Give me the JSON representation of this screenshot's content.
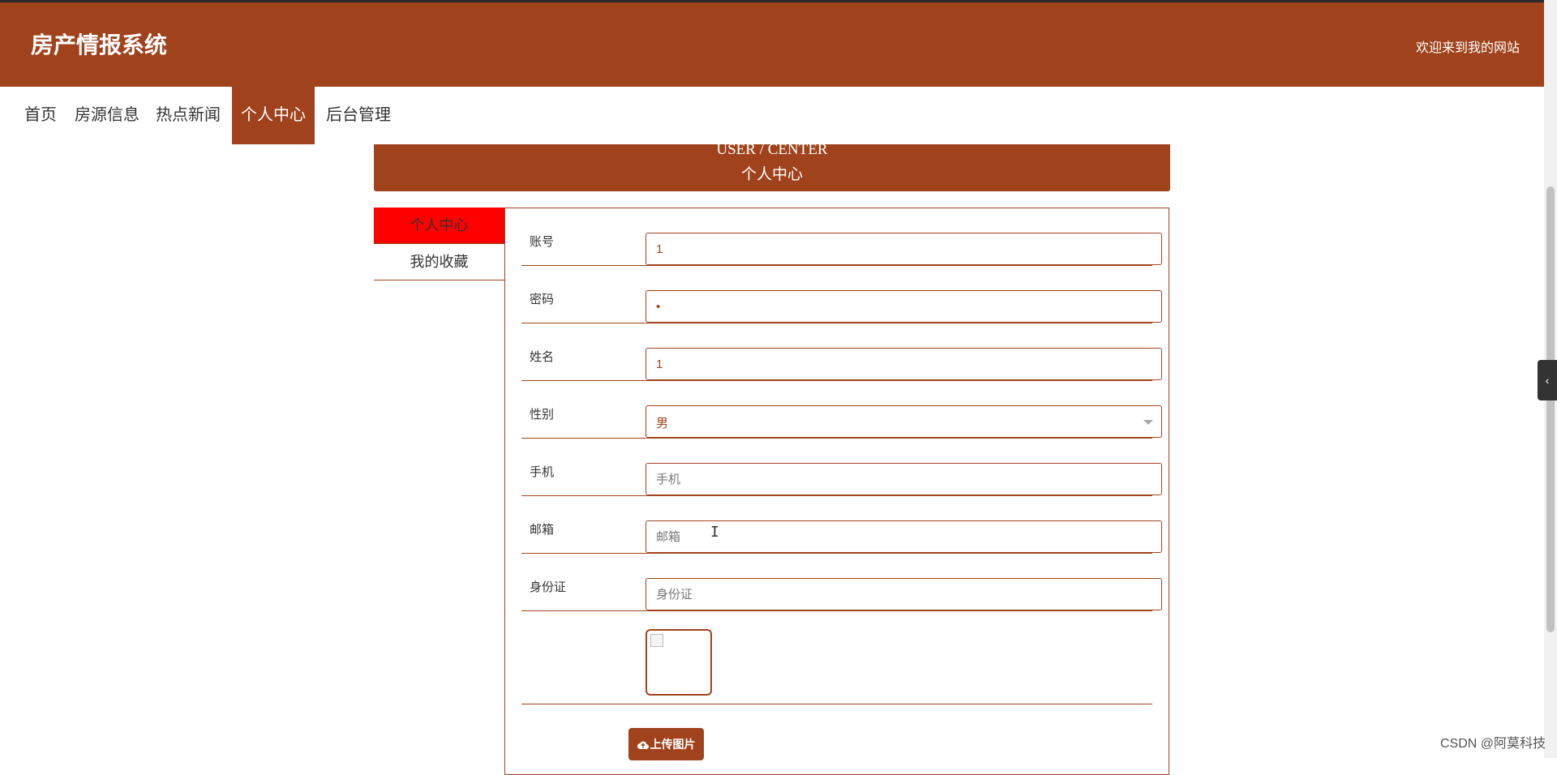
{
  "header": {
    "title": "房产情报系统",
    "welcome": "欢迎来到我的网站"
  },
  "nav": {
    "items": [
      {
        "label": "首页"
      },
      {
        "label": "房源信息"
      },
      {
        "label": "热点新闻"
      },
      {
        "label": "个人中心",
        "active": true
      },
      {
        "label": "后台管理"
      }
    ]
  },
  "banner": {
    "en": "USER / CENTER",
    "cn": "个人中心"
  },
  "side": {
    "items": [
      {
        "label": "个人中心",
        "active": true
      },
      {
        "label": "我的收藏"
      }
    ]
  },
  "form": {
    "account": {
      "label": "账号",
      "value": "1"
    },
    "password": {
      "label": "密码",
      "value": "•"
    },
    "name": {
      "label": "姓名",
      "value": "1"
    },
    "gender": {
      "label": "性别",
      "value": "男"
    },
    "phone": {
      "label": "手机",
      "placeholder": "手机"
    },
    "email": {
      "label": "邮箱",
      "placeholder": "邮箱"
    },
    "idcard": {
      "label": "身份证",
      "placeholder": "身份证"
    },
    "upload_label": "上传图片"
  },
  "watermark": "CSDN @阿莫科技",
  "colors": {
    "primary": "#a0431d",
    "active_side": "#ff0000"
  }
}
